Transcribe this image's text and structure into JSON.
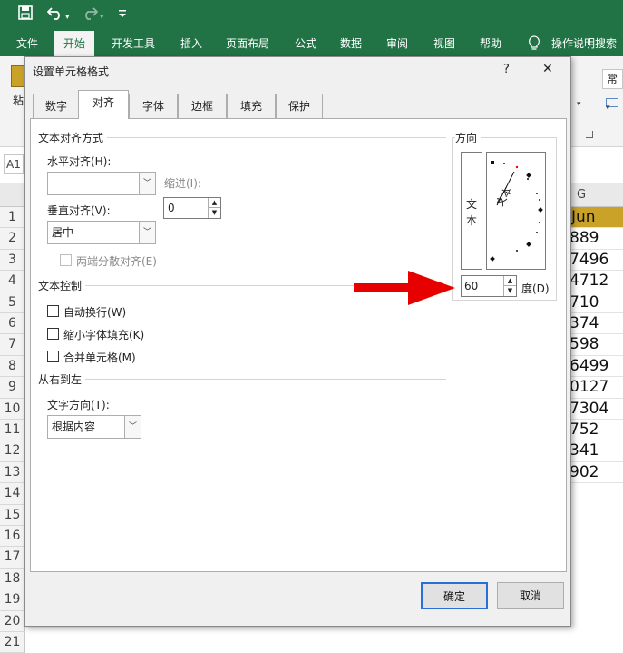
{
  "quick_access": {
    "save_icon": "save-icon",
    "undo_icon": "undo-icon",
    "redo_icon": "redo-icon",
    "customize_icon": "customize-icon"
  },
  "menu": {
    "items": [
      "文件",
      "开始",
      "开发工具",
      "插入",
      "页面布局",
      "公式",
      "数据",
      "审阅",
      "视图",
      "帮助"
    ],
    "search_label": "操作说明搜索"
  },
  "ribbon": {
    "paste_label": "粘",
    "number_format": "常"
  },
  "namebox": "A1",
  "column_g": "G",
  "rows": [
    "1",
    "2",
    "3",
    "4",
    "5",
    "6",
    "7",
    "8",
    "9",
    "10",
    "11",
    "12",
    "13",
    "14",
    "15",
    "16",
    "17",
    "18",
    "19",
    "20",
    "21"
  ],
  "col_g_values": [
    "Jun",
    "889",
    "7496",
    "4712",
    "710",
    "374",
    "598",
    "6499",
    "0127",
    "7304",
    "752",
    "341",
    "902"
  ],
  "dialog": {
    "title": "设置单元格格式",
    "help": "?",
    "close": "✕",
    "tabs": [
      "数字",
      "对齐",
      "字体",
      "边框",
      "填充",
      "保护"
    ],
    "text_alignment": {
      "section": "文本对齐方式",
      "horizontal_label": "水平对齐(H):",
      "horizontal_value": "",
      "indent_label": "缩进(I):",
      "indent_value": "0",
      "vertical_label": "垂直对齐(V):",
      "vertical_value": "居中",
      "distributed_label": "两端分散对齐(E)"
    },
    "text_control": {
      "section": "文本控制",
      "wrap": "自动换行(W)",
      "shrink": "缩小字体填充(K)",
      "merge": "合并单元格(M)"
    },
    "rtl": {
      "section": "从右到左",
      "direction_label": "文字方向(T):",
      "direction_value": "根据内容"
    },
    "orientation": {
      "section": "方向",
      "vertical_text_1": "文",
      "vertical_text_2": "本",
      "angle_text": "文本",
      "degrees": "60",
      "degree_label": "度(D)"
    },
    "ok": "确定",
    "cancel": "取消"
  },
  "colors": {
    "excel_green": "#217346",
    "arrow_red": "#e60000",
    "header_gold": "#c9a227"
  }
}
